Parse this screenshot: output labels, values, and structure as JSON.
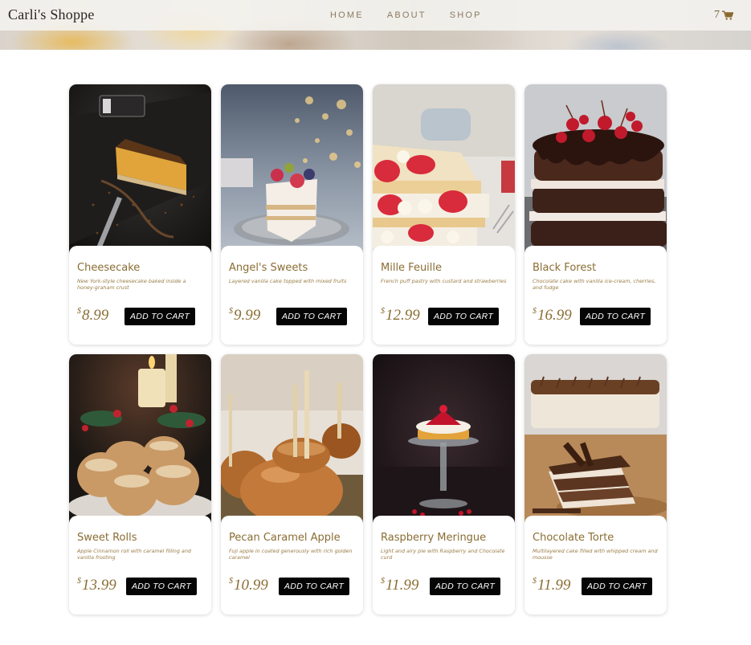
{
  "header": {
    "brand": "Carli's Shoppe",
    "nav": [
      "HOME",
      "ABOUT",
      "SHOP"
    ],
    "cart_count": "7"
  },
  "products": [
    {
      "name": "Cheesecake",
      "description": "New York-style cheesecake baked inside a honey-graham crust",
      "currency": "$",
      "price": "8.99",
      "button": "ADD TO CART"
    },
    {
      "name": "Angel's Sweets",
      "description": "Layered vanilla cake topped with mixed fruits",
      "currency": "$",
      "price": "9.99",
      "button": "ADD TO CART"
    },
    {
      "name": "Mille Feuille",
      "description": "French puff pastry with custard and strawberries",
      "currency": "$",
      "price": "12.99",
      "button": "ADD TO CART"
    },
    {
      "name": "Black Forest",
      "description": "Chocolate cake with vanilla ice-cream, cherries, and fudge",
      "currency": "$",
      "price": "16.99",
      "button": "ADD TO CART"
    },
    {
      "name": "Sweet Rolls",
      "description": "Apple Cinnamon roll with caramel filling and vanilla frosting",
      "currency": "$",
      "price": "13.99",
      "button": "ADD TO CART"
    },
    {
      "name": "Pecan Caramel Apple",
      "description": "Fuji apple in coated generously with rich golden caramel",
      "currency": "$",
      "price": "10.99",
      "button": "ADD TO CART"
    },
    {
      "name": "Raspberry Meringue",
      "description": "Light and airy pie with Raspberry and Chocolate curd",
      "currency": "$",
      "price": "11.99",
      "button": "ADD TO CART"
    },
    {
      "name": "Chocolate Torte",
      "description": "Multilayered cake filled with whipped cream and mousse",
      "currency": "$",
      "price": "11.99",
      "button": "ADD TO CART"
    }
  ],
  "colors": {
    "accent": "#8a6d33",
    "button_bg": "#050505",
    "button_text": "#ffffff"
  }
}
